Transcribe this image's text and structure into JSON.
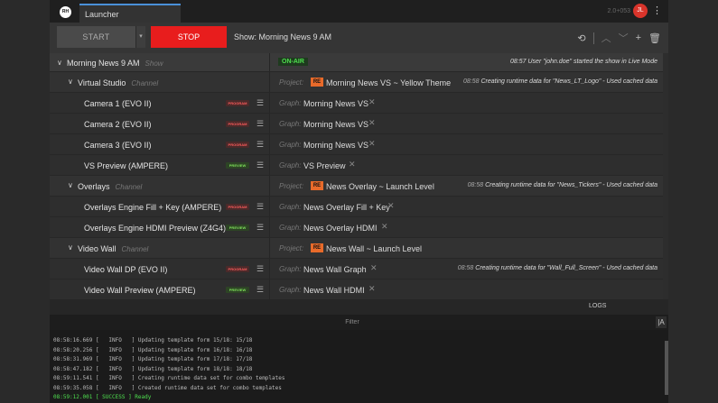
{
  "app": {
    "logo": "RH",
    "tab": "Launcher",
    "version": "2.0+053",
    "user_initials": "JL"
  },
  "controls": {
    "start": "START",
    "start_dropdown": "▾",
    "stop": "STOP",
    "show_title": "Show: Morning News 9 AM"
  },
  "show": {
    "name": "Morning News 9 AM",
    "type": "Show",
    "status": "ON-AIR",
    "message": "08:57 User \"john.doe\" started the show in Live Mode"
  },
  "channels": [
    {
      "name": "Virtual Studio",
      "type": "Channel",
      "project_label": "Project:",
      "project_badge": "RE",
      "project": "Morning News VS ~ Yellow Theme",
      "note_time": "08:58",
      "note": "Creating runtime data for \"News_LT_Logo\" - Used cached data",
      "graphs": [
        {
          "name": "Camera 1 (EVO II)",
          "badge": "PROGRAM",
          "label": "Graph:",
          "value": "Morning News VS"
        },
        {
          "name": "Camera 2 (EVO II)",
          "badge": "PROGRAM",
          "label": "Graph:",
          "value": "Morning News VS"
        },
        {
          "name": "Camera 3 (EVO II)",
          "badge": "PROGRAM",
          "label": "Graph:",
          "value": "Morning News VS"
        },
        {
          "name": "VS Preview (AMPERE)",
          "badge": "PREVIEW",
          "label": "Graph:",
          "value": "VS Preview"
        }
      ]
    },
    {
      "name": "Overlays",
      "type": "Channel",
      "project_label": "Project:",
      "project_badge": "RE",
      "project": "News Overlay ~ Launch Level",
      "note_time": "08:58",
      "note": "Creating runtime data for \"News_Tickers\" - Used cached data",
      "graphs": [
        {
          "name": "Overlays Engine Fill + Key  (AMPERE)",
          "badge": "PROGRAM",
          "label": "Graph:",
          "value": "News Overlay Fill + Key"
        },
        {
          "name": "Overlays Engine HDMI Preview (Z4G4)",
          "badge": "PREVIEW",
          "label": "Graph:",
          "value": "News Overlay HDMI"
        }
      ]
    },
    {
      "name": "Video Wall",
      "type": "Channel",
      "project_label": "Project:",
      "project_badge": "RE",
      "project": "News Wall ~ Launch Level",
      "note_time": "",
      "note": "",
      "graphs": [
        {
          "name": "Video Wall DP (EVO II)",
          "badge": "PROGRAM",
          "label": "Graph:",
          "value": "News Wall Graph",
          "note_time": "08:58",
          "note": "Creating runtime data for \"Wall_Full_Screen\" - Used cached data"
        },
        {
          "name": "Video Wall Preview  (AMPERE)",
          "badge": "PREVIEW",
          "label": "Graph:",
          "value": "News Wall HDMI"
        }
      ]
    }
  ],
  "logs": {
    "tab": "LOGS",
    "filter_placeholder": "Filter",
    "filter_button": "|A",
    "lines": [
      {
        "text": "08:58:16.669 [   INFO   ] Updating template form 15/18: 15/18",
        "level": "info"
      },
      {
        "text": "08:58:20.256 [   INFO   ] Updating template form 16/18: 16/18",
        "level": "info"
      },
      {
        "text": "08:58:31.969 [   INFO   ] Updating template form 17/18: 17/18",
        "level": "info"
      },
      {
        "text": "08:58:47.182 [   INFO   ] Updating template form 18/18: 18/18",
        "level": "info"
      },
      {
        "text": "08:59:11.541 [   INFO   ] Creating runtime data set for combo templates",
        "level": "info"
      },
      {
        "text": "08:59:35.058 [   INFO   ] Created runtime data set for combo templates",
        "level": "info"
      },
      {
        "text": "08:59:12.001 [ SUCCESS ] Ready",
        "level": "success"
      }
    ]
  }
}
